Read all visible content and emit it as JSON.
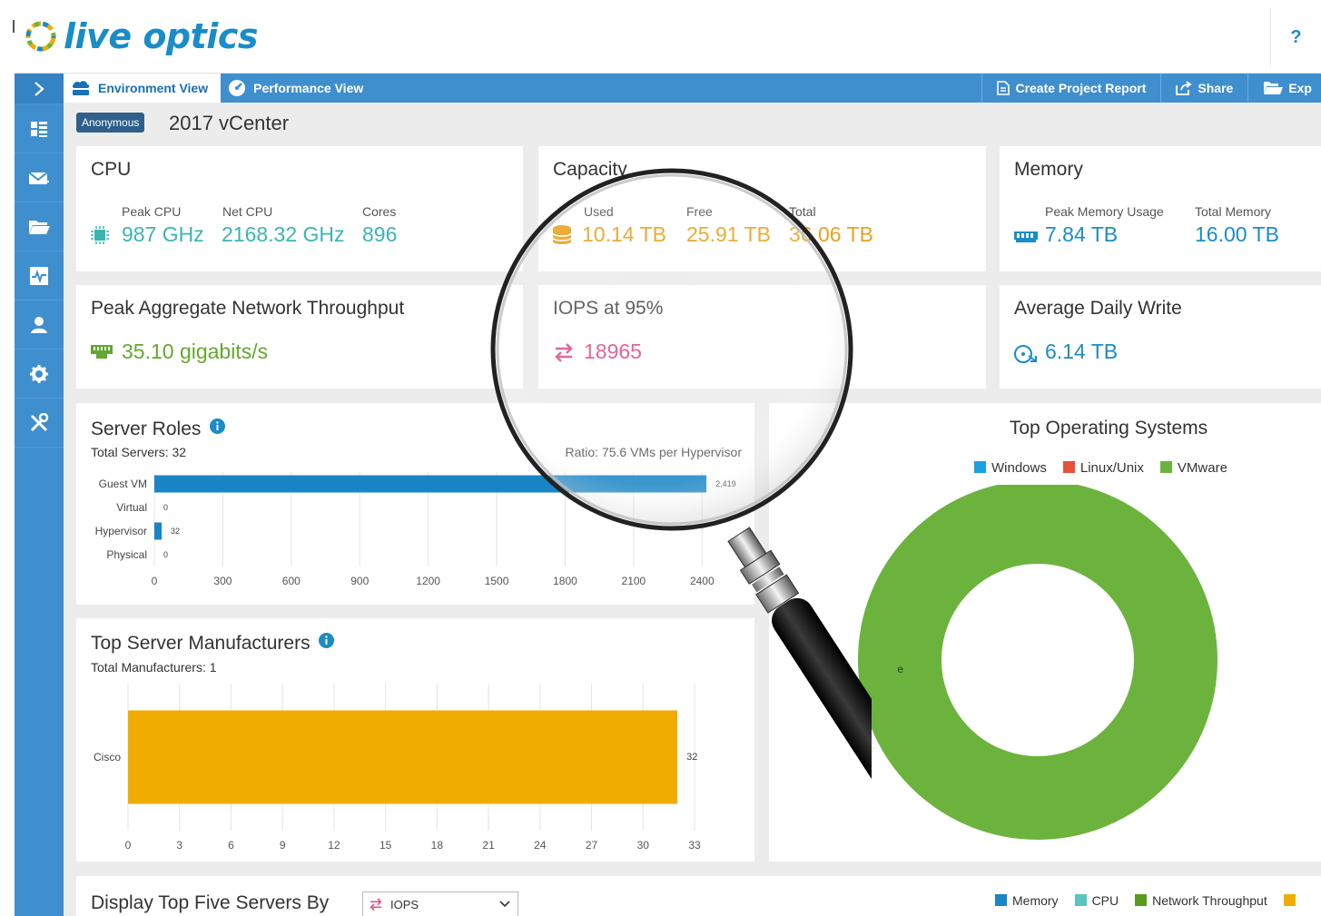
{
  "app": {
    "logo_text": "live optics",
    "help_label": "?"
  },
  "sidebar": {
    "items": [
      {
        "icon": "chevron-right-icon"
      },
      {
        "icon": "dashboard-icon"
      },
      {
        "icon": "mail-icon"
      },
      {
        "icon": "folder-icon"
      },
      {
        "icon": "activity-icon"
      },
      {
        "icon": "user-icon"
      },
      {
        "icon": "gear-icon"
      },
      {
        "icon": "tools-icon"
      }
    ]
  },
  "tabs": [
    {
      "label": "Environment View",
      "icon": "cloud-server-icon",
      "active": true
    },
    {
      "label": "Performance View",
      "icon": "gauge-icon",
      "active": false
    }
  ],
  "actions": [
    {
      "label": "Create Project Report",
      "icon": "document-icon"
    },
    {
      "label": "Share",
      "icon": "share-icon"
    },
    {
      "label": "Exp",
      "icon": "export-folder-icon"
    }
  ],
  "project": {
    "badge": "Anonymous",
    "name": "2017 vCenter"
  },
  "cpu": {
    "title": "CPU",
    "peak_label": "Peak CPU",
    "peak_value": "987 GHz",
    "net_label": "Net CPU",
    "net_value": "2168.32 GHz",
    "cores_label": "Cores",
    "cores_value": "896"
  },
  "capacity": {
    "title": "Capacity",
    "used_label": "Used",
    "used_value": "10.14 TB",
    "free_label": "Free",
    "free_value": "25.91 TB",
    "total_label": "Total",
    "total_value": "36.06 TB"
  },
  "memory": {
    "title": "Memory",
    "peak_label": "Peak Memory Usage",
    "peak_value": "7.84 TB",
    "total_label": "Total Memory",
    "total_value": "16.00 TB"
  },
  "network": {
    "title": "Peak Aggregate Network Throughput",
    "value": "35.10 gigabits/s"
  },
  "iops": {
    "title": "IOPS at 95%",
    "value": "18965"
  },
  "daily_write": {
    "title": "Average Daily Write",
    "value": "6.14 TB"
  },
  "colors": {
    "accent": "#3f8fcf",
    "cpu": "#3bb5b0",
    "capacity": "#e8a21f",
    "memory": "#1a8cc8",
    "network": "#63a82e",
    "iops": "#e0568e",
    "bar_blue": "#1a85c6",
    "bar_orange": "#f0ad00",
    "vmware": "#6cb33e",
    "windows": "#1aa1e1",
    "linux": "#e8503a"
  },
  "server_roles": {
    "title": "Server Roles",
    "subtitle": "Total Servers: 32",
    "ratio": "Ratio: 75.6 VMs per Hypervisor"
  },
  "manufacturers": {
    "title": "Top Server Manufacturers",
    "subtitle": "Total Manufacturers: 1"
  },
  "os": {
    "title": "Top Operating Systems",
    "legend": [
      {
        "label": "Windows",
        "color": "#1aa1e1"
      },
      {
        "label": "Linux/Unix",
        "color": "#e8503a"
      },
      {
        "label": "VMware",
        "color": "#6cb33e"
      }
    ],
    "callout": "e"
  },
  "top_five": {
    "label": "Display Top Five Servers By",
    "select_value": "IOPS",
    "legend": [
      {
        "label": "Memory",
        "color": "#1a85c6"
      },
      {
        "label": "CPU",
        "color": "#5bc4c0"
      },
      {
        "label": "Network Throughput",
        "color": "#5a9a1e"
      },
      {
        "label": "",
        "color": "#f0ad00"
      }
    ]
  },
  "chart_data": [
    {
      "type": "bar",
      "orientation": "horizontal",
      "title": "Server Roles",
      "categories": [
        "Guest VM",
        "Virtual",
        "Hypervisor",
        "Physical"
      ],
      "values": [
        2419,
        0,
        32,
        0
      ],
      "value_labels": [
        "2,419",
        "0",
        "32",
        "0"
      ],
      "xticks": [
        "0",
        "300",
        "600",
        "900",
        "1200",
        "1500",
        "1800",
        "2100",
        "2400"
      ],
      "xlim": [
        0,
        2550
      ],
      "color": "#1a85c6",
      "grid": true
    },
    {
      "type": "bar",
      "orientation": "horizontal",
      "title": "Top Server Manufacturers",
      "categories": [
        "Cisco"
      ],
      "values": [
        32
      ],
      "value_labels": [
        "32"
      ],
      "xticks": [
        "0",
        "3",
        "6",
        "9",
        "12",
        "15",
        "18",
        "21",
        "24",
        "27",
        "30",
        "33"
      ],
      "xlim": [
        0,
        33
      ],
      "color": "#f0ad00",
      "grid": true
    },
    {
      "type": "pie",
      "title": "Top Operating Systems",
      "donut": true,
      "labels": [
        "Windows",
        "Linux/Unix",
        "VMware"
      ],
      "values": [
        0,
        0,
        100
      ]
    }
  ]
}
